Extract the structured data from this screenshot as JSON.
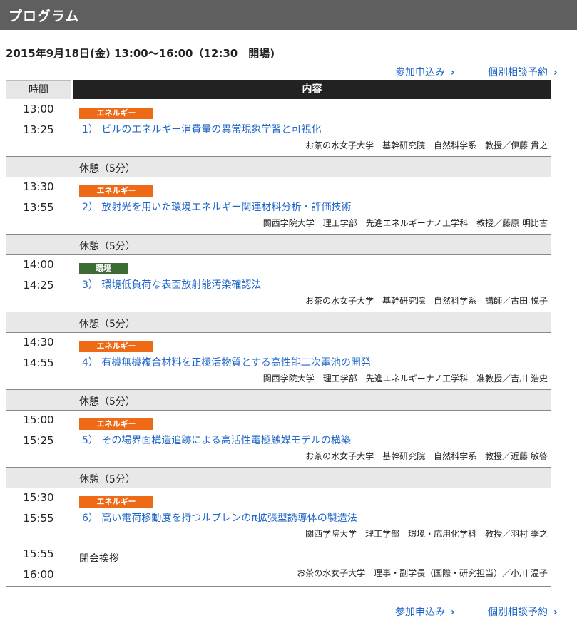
{
  "header": {
    "title": "プログラム"
  },
  "event": {
    "date_line": "2015年9月18日(金) 13:00〜16:00（12:30　開場)"
  },
  "links": {
    "apply": "参加申込み",
    "consult": "個別相談予約",
    "chevron": "›"
  },
  "table": {
    "col_time": "時間",
    "col_content": "内容"
  },
  "sessions": [
    {
      "start": "13:00",
      "end": "13:25",
      "tag": "エネルギー",
      "title": "1）  ビルのエネルギー消費量の異常現象学習と可視化",
      "speaker": "お茶の水女子大学　基幹研究院　自然科学系　教授／伊藤 貴之"
    },
    {
      "start": "13:30",
      "end": "13:55",
      "tag": "エネルギー",
      "title": "2）  放射光を用いた環境エネルギー関連材料分析・評価技術",
      "speaker": "関西学院大学　理工学部　先進エネルギーナノ工学科　教授／藤原 明比古"
    },
    {
      "start": "14:00",
      "end": "14:25",
      "tag": "環境",
      "title": "3）  環境低負荷な表面放射能汚染確認法",
      "speaker": "お茶の水女子大学　基幹研究院　自然科学系　講師／古田 悦子"
    },
    {
      "start": "14:30",
      "end": "14:55",
      "tag": "エネルギー",
      "title": "4）  有機無機複合材料を正極活物質とする高性能二次電池の開発",
      "speaker": "関西学院大学　理工学部　先進エネルギーナノ工学科　准教授／吉川 浩史"
    },
    {
      "start": "15:00",
      "end": "15:25",
      "tag": "エネルギー",
      "title": "5）  その場界面構造追跡による高活性電極触媒モデルの構築",
      "speaker": "お茶の水女子大学　基幹研究院　自然科学系　教授／近藤 敏啓"
    },
    {
      "start": "15:30",
      "end": "15:55",
      "tag": "エネルギー",
      "title": "6）  高い電荷移動度を持つルブレンのπ拡張型誘導体の製造法",
      "speaker": "関西学院大学　理工学部　環境・応用化学科　教授／羽村 季之"
    }
  ],
  "break_label": "休憩（5分）",
  "closing": {
    "start": "15:55",
    "end": "16:00",
    "title": "閉会挨拶",
    "speaker": "お茶の水女子大学　理事・副学長（国際・研究担当）／小川 温子"
  },
  "colors": {
    "energy_tag": "#ee6a17",
    "env_tag": "#3c6b36",
    "link": "#1f66c8",
    "header_bg": "#5f5f5f"
  }
}
